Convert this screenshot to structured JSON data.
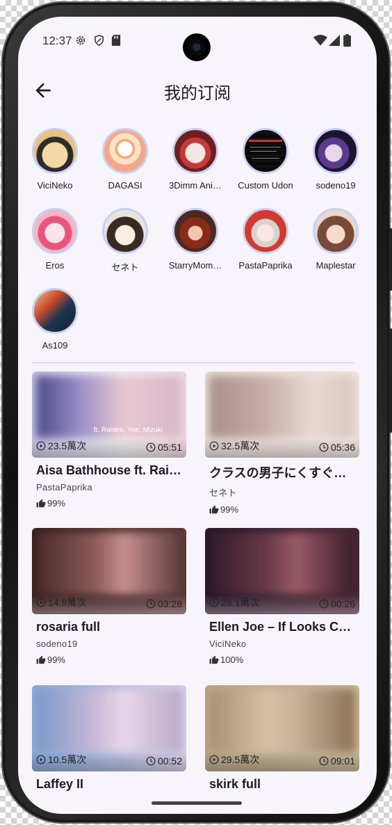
{
  "status_bar": {
    "time": "12:37"
  },
  "app_bar": {
    "title": "我的订阅"
  },
  "subscriptions": [
    {
      "name": "ViciNeko"
    },
    {
      "name": "DAGASI"
    },
    {
      "name": "3Dimm Ani…"
    },
    {
      "name": "Custom Udon"
    },
    {
      "name": "sodeno19"
    },
    {
      "name": "Eros"
    },
    {
      "name": "セネト"
    },
    {
      "name": "StarryMom…"
    },
    {
      "name": "PastaPaprika"
    },
    {
      "name": "Maplestar"
    },
    {
      "name": "As109"
    }
  ],
  "videos": [
    {
      "title": "Aisa Bathhouse ft. Rai…",
      "author": "PastaPaprika",
      "views": "23.5萬次",
      "duration": "05:51",
      "like": "99%",
      "thumb_overlay": "ft. Raiden, Yae, Mizuki"
    },
    {
      "title": "クラスの男子にくすぐ…",
      "author": "セネト",
      "views": "32.5萬次",
      "duration": "05:36",
      "like": "99%"
    },
    {
      "title": "rosaria full",
      "author": "sodeno19",
      "views": "14.9萬次",
      "duration": "03:28",
      "like": "99%"
    },
    {
      "title": "Ellen Joe – If Looks C…",
      "author": "ViciNeko",
      "views": "28.1萬次",
      "duration": "00:26",
      "like": "100%"
    },
    {
      "title": "Laffey II",
      "author": "",
      "views": "10.5萬次",
      "duration": "00:52",
      "like": ""
    },
    {
      "title": "skirk full",
      "author": "",
      "views": "29.5萬次",
      "duration": "09:01",
      "like": ""
    }
  ],
  "colors": {
    "background": "#f7f4fb",
    "avatar_ring": "#c9cff5",
    "text": "#1c1b1f"
  }
}
